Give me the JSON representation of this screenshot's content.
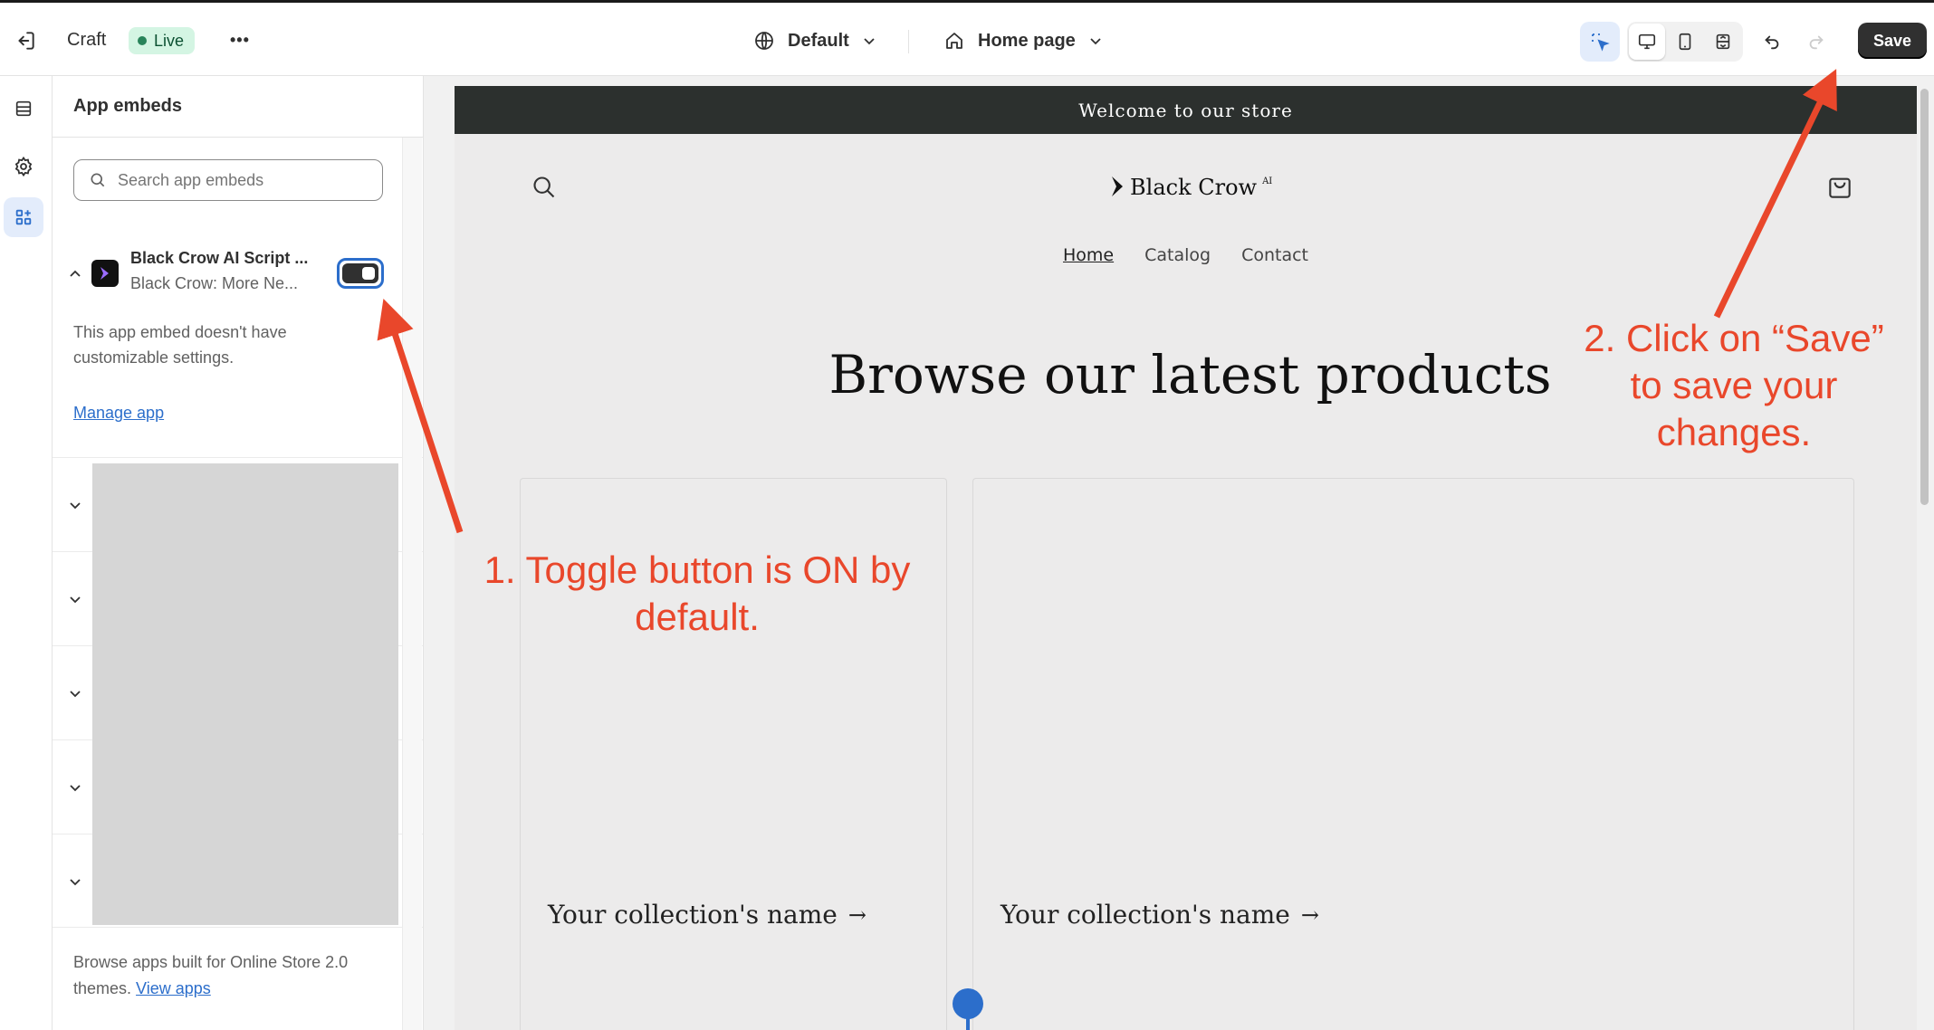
{
  "topbar": {
    "exit_icon": "exit-icon",
    "store_name": "Craft",
    "status_badge": "Live",
    "more_label": "•••",
    "theme_select": "Default",
    "page_select": "Home page",
    "save_label": "Save"
  },
  "sidebar": {
    "title": "App embeds",
    "search_placeholder": "Search app embeds",
    "embed": {
      "name": "Black Crow AI Script ...",
      "subtitle": "Black Crow: More Ne...",
      "toggle_on": true,
      "description": "This app embed doesn't have customizable settings.",
      "manage_link": "Manage app"
    },
    "footer_text": "Browse apps built for Online Store 2.0 themes.",
    "footer_link": "View apps"
  },
  "store": {
    "announcement": "Welcome to our store",
    "logo_text": "Black Crow",
    "logo_superscript": "AI",
    "nav": [
      "Home",
      "Catalog",
      "Contact"
    ],
    "heading": "Browse our latest products",
    "collections": [
      "Your collection's name",
      "Your collection's name"
    ],
    "arrow": "→"
  },
  "annotations": {
    "toggle_note": "1. Toggle button is ON by default.",
    "save_note": "2. Click on “Save” to save your changes."
  },
  "colors": {
    "accent_blue": "#2c6ecb",
    "annotation_red": "#e9472b",
    "announcement_bg": "#2c302e",
    "live_green": "#29845a"
  }
}
